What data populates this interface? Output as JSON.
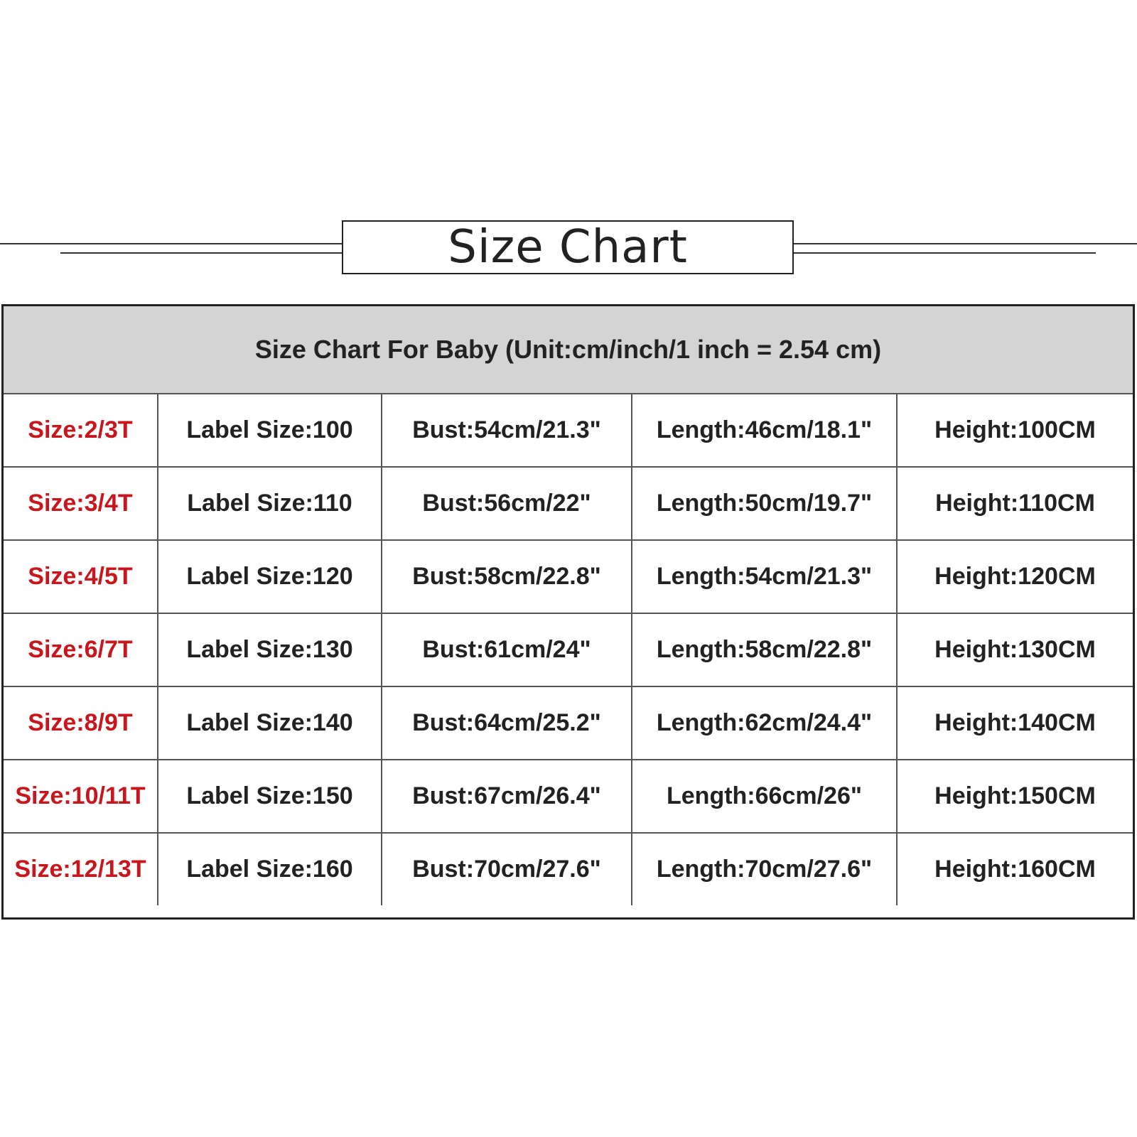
{
  "title": "Size Chart",
  "subtitle": "Size Chart For Baby (Unit:cm/inch/1 inch = 2.54 cm)",
  "colors": {
    "size_text": "#c8161d",
    "header_bg": "#d4d4d4",
    "text": "#222222"
  },
  "rows": [
    [
      "Size:2/3T",
      "Label Size:100",
      "Bust:54cm/21.3\"",
      "Length:46cm/18.1\"",
      "Height:100CM"
    ],
    [
      "Size:3/4T",
      "Label Size:110",
      "Bust:56cm/22\"",
      "Length:50cm/19.7\"",
      "Height:110CM"
    ],
    [
      "Size:4/5T",
      "Label Size:120",
      "Bust:58cm/22.8\"",
      "Length:54cm/21.3\"",
      "Height:120CM"
    ],
    [
      "Size:6/7T",
      "Label Size:130",
      "Bust:61cm/24\"",
      "Length:58cm/22.8\"",
      "Height:130CM"
    ],
    [
      "Size:8/9T",
      "Label Size:140",
      "Bust:64cm/25.2\"",
      "Length:62cm/24.4\"",
      "Height:140CM"
    ],
    [
      "Size:10/11T",
      "Label Size:150",
      "Bust:67cm/26.4\"",
      "Length:66cm/26\"",
      "Height:150CM"
    ],
    [
      "Size:12/13T",
      "Label Size:160",
      "Bust:70cm/27.6\"",
      "Length:70cm/27.6\"",
      "Height:160CM"
    ]
  ]
}
